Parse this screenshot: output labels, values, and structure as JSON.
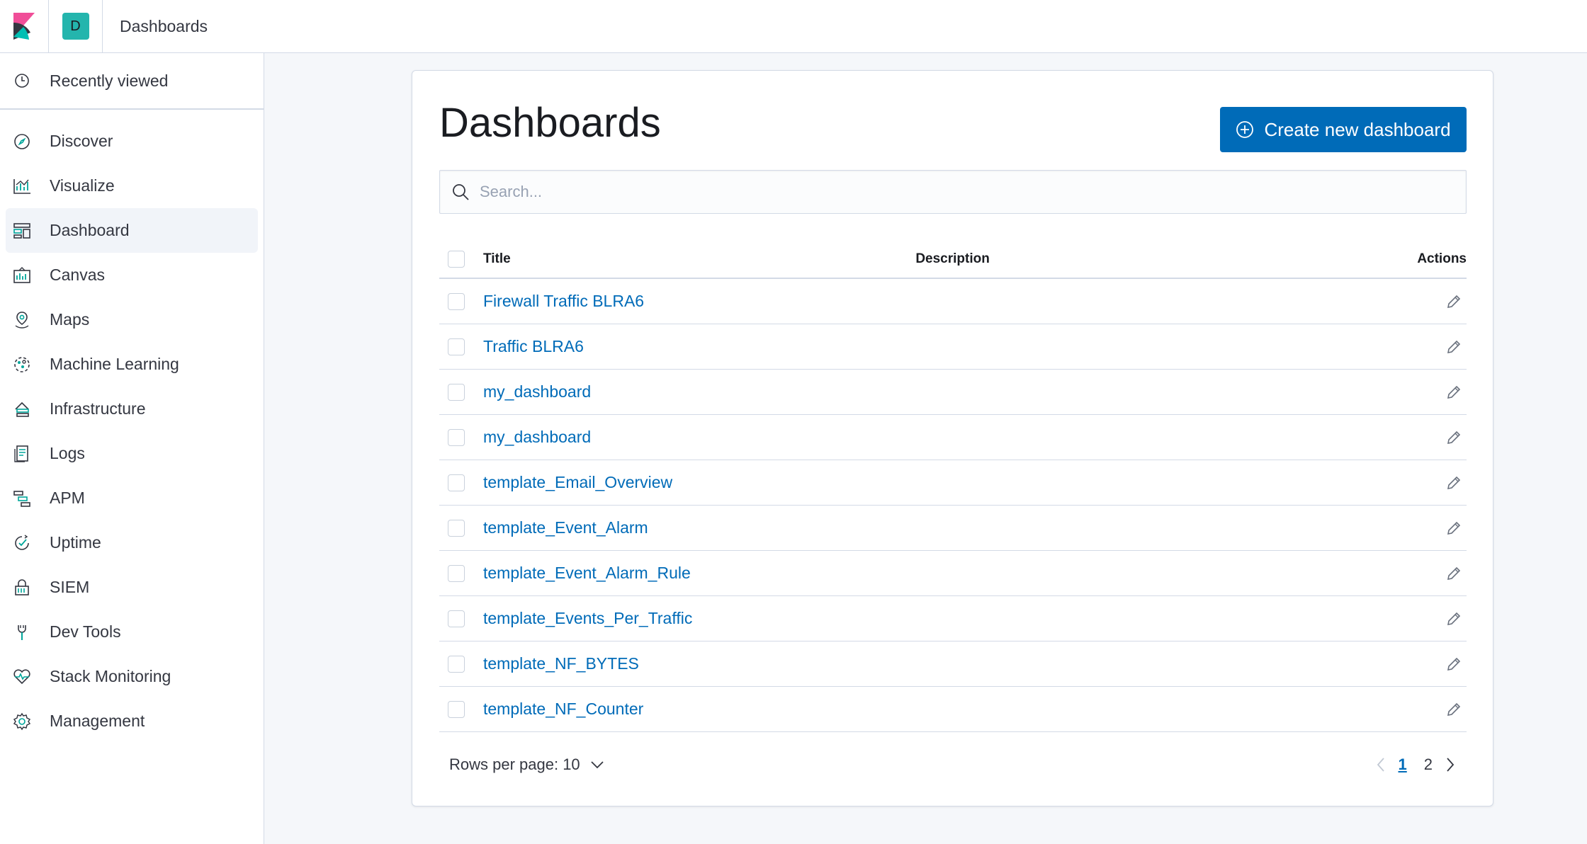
{
  "header": {
    "logo": "kibana-logo",
    "space_initial": "D",
    "breadcrumb": "Dashboards"
  },
  "sidebar": {
    "recent": {
      "label": "Recently viewed",
      "icon": "clock-icon"
    },
    "items": [
      {
        "label": "Discover",
        "icon": "compass-icon",
        "active": false
      },
      {
        "label": "Visualize",
        "icon": "chart-icon",
        "active": false
      },
      {
        "label": "Dashboard",
        "icon": "dashboard-icon",
        "active": true
      },
      {
        "label": "Canvas",
        "icon": "canvas-icon",
        "active": false
      },
      {
        "label": "Maps",
        "icon": "map-pin-icon",
        "active": false
      },
      {
        "label": "Machine Learning",
        "icon": "ml-icon",
        "active": false
      },
      {
        "label": "Infrastructure",
        "icon": "infrastructure-icon",
        "active": false
      },
      {
        "label": "Logs",
        "icon": "logs-icon",
        "active": false
      },
      {
        "label": "APM",
        "icon": "apm-icon",
        "active": false
      },
      {
        "label": "Uptime",
        "icon": "uptime-icon",
        "active": false
      },
      {
        "label": "SIEM",
        "icon": "lock-icon",
        "active": false
      },
      {
        "label": "Dev Tools",
        "icon": "wrench-icon",
        "active": false
      },
      {
        "label": "Stack Monitoring",
        "icon": "heartbeat-icon",
        "active": false
      },
      {
        "label": "Management",
        "icon": "gear-icon",
        "active": false
      }
    ]
  },
  "main": {
    "title": "Dashboards",
    "create_button": "Create new dashboard",
    "search": {
      "placeholder": "Search...",
      "value": ""
    },
    "table": {
      "columns": {
        "title": "Title",
        "description": "Description",
        "actions": "Actions"
      },
      "rows": [
        {
          "title": "Firewall Traffic BLRA6",
          "description": ""
        },
        {
          "title": "Traffic BLRA6",
          "description": ""
        },
        {
          "title": "my_dashboard",
          "description": ""
        },
        {
          "title": "my_dashboard",
          "description": ""
        },
        {
          "title": "template_Email_Overview",
          "description": ""
        },
        {
          "title": "template_Event_Alarm",
          "description": ""
        },
        {
          "title": "template_Event_Alarm_Rule",
          "description": ""
        },
        {
          "title": "template_Events_Per_Traffic",
          "description": ""
        },
        {
          "title": "template_NF_BYTES",
          "description": ""
        },
        {
          "title": "template_NF_Counter",
          "description": ""
        }
      ]
    },
    "pagination": {
      "rows_per_page": "Rows per page: 10",
      "pages": [
        "1",
        "2"
      ],
      "current_page": "1"
    }
  },
  "colors": {
    "accent": "#006bb8",
    "space_avatar": "#24b5ad",
    "border": "#d3dae6",
    "background": "#f5f7fa"
  }
}
